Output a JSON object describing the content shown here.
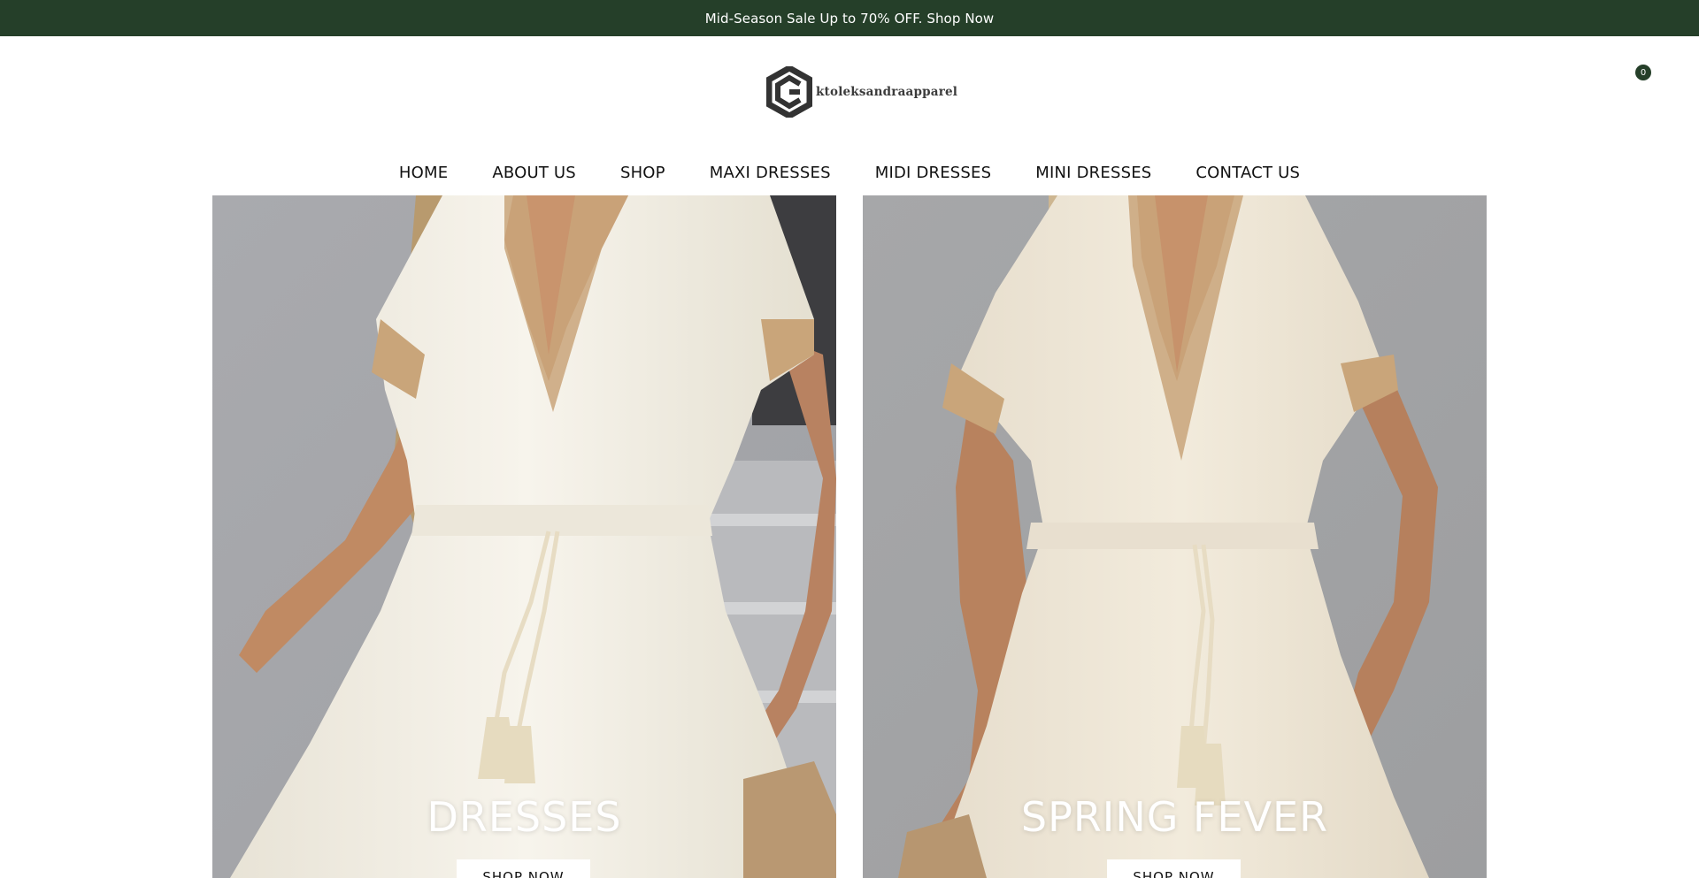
{
  "announcement": {
    "text": "Mid-Season Sale Up to 70% OFF. Shop Now"
  },
  "header": {
    "brand": "ktoleksandraapparel",
    "cart_count": "0"
  },
  "nav": {
    "items": [
      {
        "label": "HOME"
      },
      {
        "label": "ABOUT US"
      },
      {
        "label": "SHOP"
      },
      {
        "label": "MAXI DRESSES"
      },
      {
        "label": "MIDI DRESSES"
      },
      {
        "label": "MINI DRESSES"
      },
      {
        "label": "CONTACT US"
      }
    ]
  },
  "banners": [
    {
      "title": "DRESSES",
      "button_label": "SHOP NOW"
    },
    {
      "title": "SPRING FEVER",
      "button_label": "SHOP NOW"
    }
  ],
  "icons": {
    "logo": "hexagon-logo-icon",
    "cart": "shopping-bag-icon"
  },
  "colors": {
    "announcement_bg": "#253f29",
    "cart_badge": "#253f29",
    "banner_wall_left": "#a7a8ac",
    "banner_wall_right": "#a2a3a5",
    "dress": "#f3efe3",
    "lace_trim": "#c9a57a"
  }
}
